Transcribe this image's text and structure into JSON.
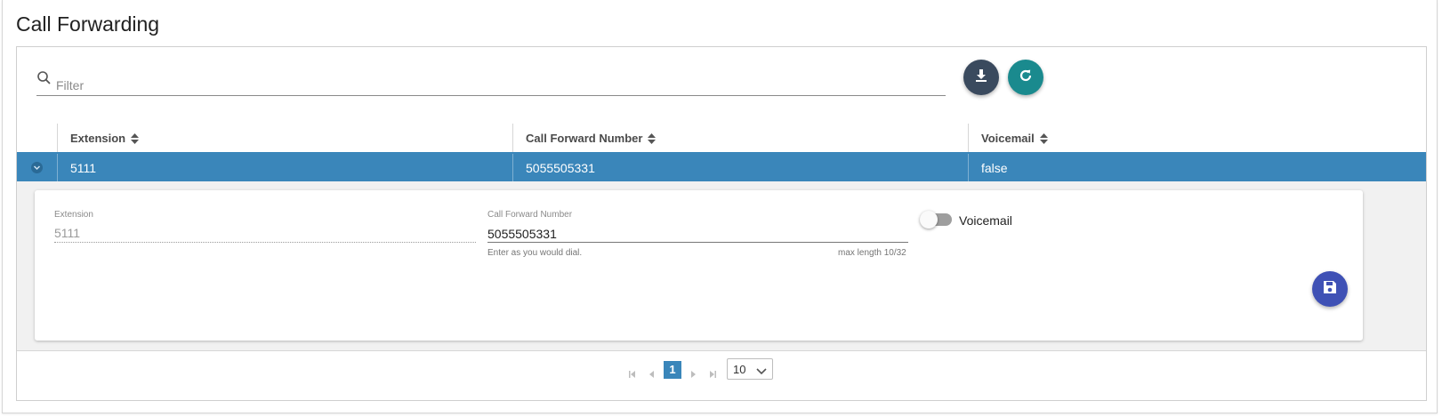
{
  "page": {
    "title": "Call Forwarding"
  },
  "toolbar": {
    "filter_placeholder": "Filter",
    "icons": {
      "filter": "search-icon",
      "download": "download-icon",
      "refresh": "refresh-icon"
    }
  },
  "grid": {
    "columns": [
      {
        "label": "Extension"
      },
      {
        "label": "Call Forward Number"
      },
      {
        "label": "Voicemail"
      }
    ],
    "rows": [
      {
        "extension": "5111",
        "call_forward_number": "5055505331",
        "voicemail": "false"
      }
    ]
  },
  "detail": {
    "extension_label": "Extension",
    "extension_value": "5111",
    "cfn_label": "Call Forward Number",
    "cfn_value": "5055505331",
    "cfn_hint": "Enter as you would dial.",
    "cfn_length": "max length 10/32",
    "voicemail_label": "Voicemail",
    "voicemail_on": false,
    "save_icon": "save-icon"
  },
  "pager": {
    "current_page": "1",
    "page_size": "10"
  },
  "colors": {
    "accent": "#3a86ba",
    "fab_download": "#3a4a5e",
    "fab_refresh": "#1a8a8e",
    "fab_save": "#3f51b5"
  }
}
